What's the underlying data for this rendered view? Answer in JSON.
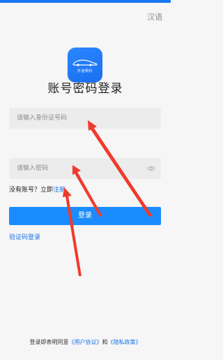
{
  "header": {
    "language_label": "汉语"
  },
  "logo": {
    "text": "乐途网约"
  },
  "page_title": "账号密码登录",
  "form": {
    "id_placeholder": "请输入身份证号码",
    "password_placeholder": "请输入密码"
  },
  "register": {
    "prompt": "没有账号？立即",
    "link": "注册"
  },
  "login_button": "登录",
  "code_login_link": "验证码登录",
  "agreement": {
    "prefix": "登录即表明同意",
    "user_agreement": "《用户协议》",
    "and": "和",
    "privacy_policy": "《隐私政策》"
  },
  "colors": {
    "accent": "#1a8cff",
    "link": "#1a73e8",
    "annotation_arrow": "#f03a2c"
  },
  "icons": {
    "password_visibility": "eye-icon"
  }
}
